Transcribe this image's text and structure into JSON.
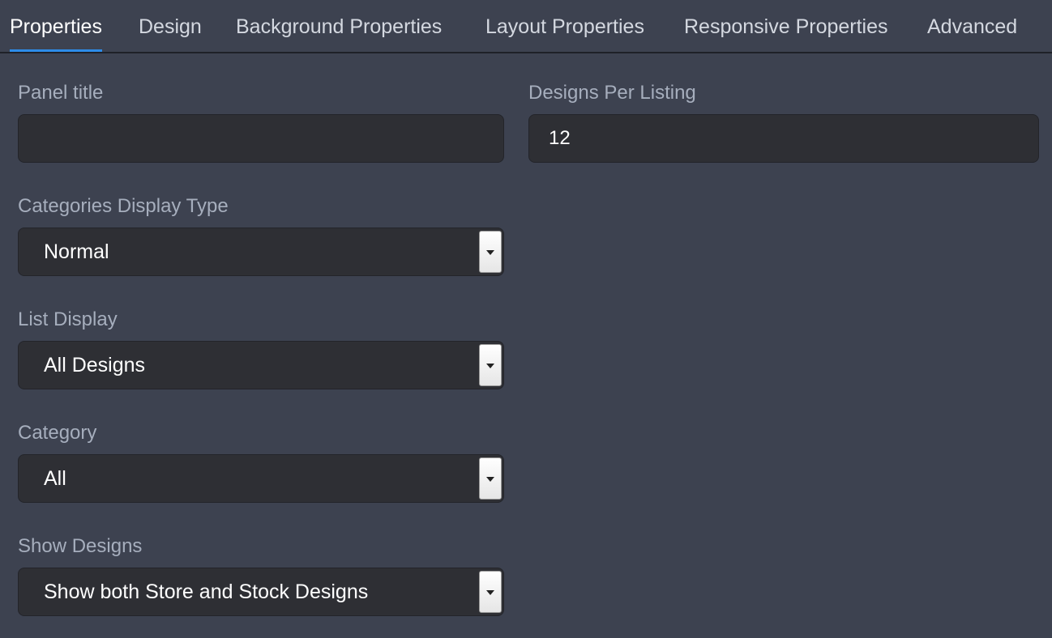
{
  "tabs": [
    {
      "label": "Properties",
      "active": true
    },
    {
      "label": "Design"
    },
    {
      "label": "Background Properties"
    },
    {
      "label": "Layout Properties"
    },
    {
      "label": "Responsive Properties"
    },
    {
      "label": "Advanced"
    }
  ],
  "form": {
    "panel_title": {
      "label": "Panel title",
      "value": ""
    },
    "designs_per_listing": {
      "label": "Designs Per Listing",
      "value": "12"
    },
    "categories_display_type": {
      "label": "Categories Display Type",
      "value": "Normal"
    },
    "list_display": {
      "label": "List Display",
      "value": "All Designs"
    },
    "category": {
      "label": "Category",
      "value": "All"
    },
    "show_designs": {
      "label": "Show Designs",
      "value": "Show both Store and Stock Designs"
    }
  },
  "colors": {
    "background": "#3d4250",
    "field_background": "#2e2f34",
    "active_tab_underline": "#2d8ce8",
    "label_text": "#a6aebd"
  },
  "icons": {
    "select_arrow": "chevron-down-icon"
  }
}
